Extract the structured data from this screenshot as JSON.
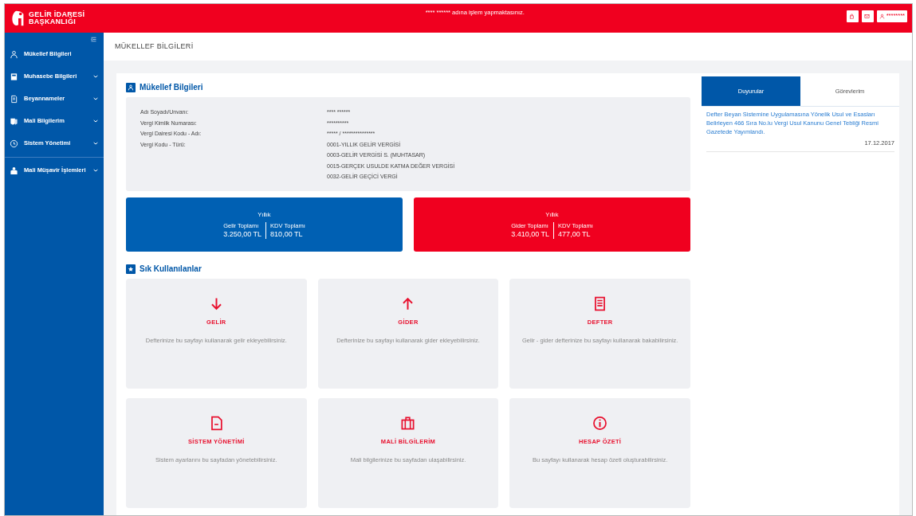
{
  "header": {
    "logo_line1": "GELİR İDARESİ",
    "logo_line2": "BAŞKANLIĞI",
    "notice": "**** ****** adına işlem yapmaktasınız.",
    "user": "********"
  },
  "sidebar": {
    "groups": [
      [
        {
          "label": "Mükellef Bilgileri",
          "expandable": false
        },
        {
          "label": "Muhasebe Bilgileri",
          "expandable": true
        },
        {
          "label": "Beyannameler",
          "expandable": true
        },
        {
          "label": "Mali Bilgilerim",
          "expandable": true
        },
        {
          "label": "Sistem Yönetimi",
          "expandable": true
        }
      ],
      [
        {
          "label": "Mali Müşavir İşlemleri",
          "expandable": true
        }
      ]
    ]
  },
  "page_title": "MÜKELLEF BİLGİLERİ",
  "taxpayer": {
    "title": "Mükellef Bilgileri",
    "fields": [
      {
        "label": "Adı Soyadı/Unvanı:",
        "values": [
          "**** ******"
        ]
      },
      {
        "label": "Vergi Kimlik Numarası:",
        "values": [
          "**********"
        ]
      },
      {
        "label": "Vergi Dairesi Kodu - Adı:",
        "values": [
          "***** / ***************"
        ]
      },
      {
        "label": "Vergi Kodu - Türü:",
        "values": [
          "0001-YILLIK GELİR VERGİSİ",
          "0003-GELİR VERGİSİ S. (MUHTASAR)",
          "0015-GERÇEK USULDE KATMA DEĞER VERGİSİ",
          "0032-GELİR GEÇİCİ VERGİ"
        ]
      }
    ]
  },
  "summaries": [
    {
      "kind": "income",
      "period": "Yıllık",
      "items": [
        {
          "label": "Gelir Toplamı",
          "value": "3.250,00 TL"
        },
        {
          "label": "KDV Toplamı",
          "value": "810,00 TL"
        }
      ]
    },
    {
      "kind": "expense",
      "period": "Yıllık",
      "items": [
        {
          "label": "Gider Toplamı",
          "value": "3.410,00 TL"
        },
        {
          "label": "KDV Toplamı",
          "value": "477,00 TL"
        }
      ]
    }
  ],
  "quick": {
    "title": "Sık Kullanılanlar",
    "tiles": [
      {
        "title": "GELİR",
        "description": "Defterinize bu sayfayı kullanarak gelir ekleyebilirsiniz."
      },
      {
        "title": "GİDER",
        "description": "Defterinize bu sayfayı kullanarak gider ekleyebilirsiniz."
      },
      {
        "title": "DEFTER",
        "description": "Gelir - gider defterinize bu sayfayı kullanarak bakabilirsiniz."
      },
      {
        "title": "SİSTEM YÖNETİMİ",
        "description": "Sistem ayarlarını bu sayfadan yönetebilirsiniz."
      },
      {
        "title": "MALİ BİLGİLERİM",
        "description": "Mali bilgilerinize bu sayfadan ulaşabilirsiniz."
      },
      {
        "title": "HESAP ÖZETİ",
        "description": "Bu sayfayı kullanarak hesap özeti oluşturabilirsiniz."
      }
    ]
  },
  "side_panel": {
    "tabs": [
      {
        "label": "Duyurular",
        "selected": true
      },
      {
        "label": "Görevlerim",
        "selected": false
      }
    ],
    "announcements": [
      {
        "text": "Defter Beyan Sistemine Uygulamasına Yönelik Usul ve Esasları Belirleyen 466 Sıra No.lu Vergi Usul Kanunu Genel Tebliği Resmi Gazetede Yayımlandı.",
        "date": "17.12.2017"
      }
    ]
  }
}
